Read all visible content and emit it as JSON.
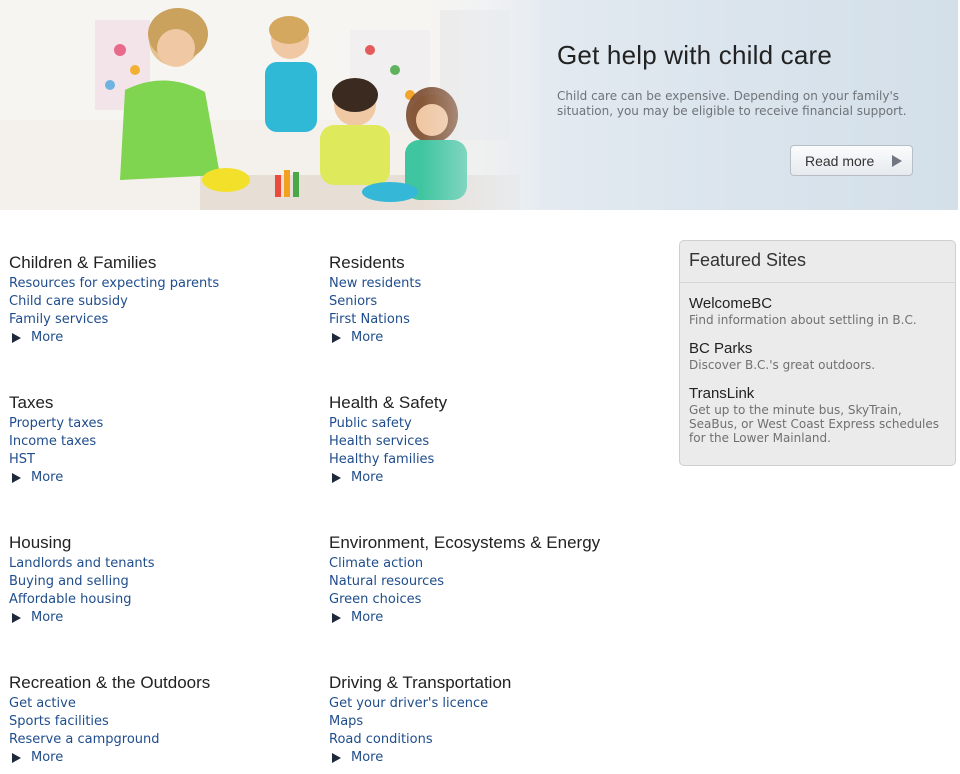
{
  "banner": {
    "title": "Get help with child care",
    "text": "Child care can be expensive. Depending on your family's situation, you may be eligible to receive financial support.",
    "read_more": "Read more"
  },
  "categories": [
    {
      "title": "Children & Families",
      "links": [
        "Resources for expecting parents",
        "Child care subsidy",
        "Family services"
      ],
      "more": "More"
    },
    {
      "title": "Residents",
      "links": [
        "New residents",
        "Seniors",
        "First Nations"
      ],
      "more": "More"
    },
    {
      "title": "Taxes",
      "links": [
        "Property taxes",
        "Income taxes",
        "HST"
      ],
      "more": "More"
    },
    {
      "title": "Health & Safety",
      "links": [
        "Public safety",
        "Health services",
        "Healthy families"
      ],
      "more": "More"
    },
    {
      "title": "Housing",
      "links": [
        "Landlords and tenants",
        "Buying and selling",
        "Affordable housing"
      ],
      "more": "More"
    },
    {
      "title": "Environment, Ecosystems & Energy",
      "links": [
        "Climate action",
        "Natural resources",
        "Green choices"
      ],
      "more": "More"
    },
    {
      "title": "Recreation & the Outdoors",
      "links": [
        "Get active",
        "Sports facilities",
        "Reserve a campground"
      ],
      "more": "More"
    },
    {
      "title": "Driving & Transportation",
      "links": [
        "Get your driver's licence",
        "Maps",
        "Road conditions"
      ],
      "more": "More"
    }
  ],
  "featured": {
    "title": "Featured Sites",
    "sites": [
      {
        "name": "WelcomeBC",
        "desc": "Find information about settling in B.C."
      },
      {
        "name": "BC Parks",
        "desc": "Discover B.C.'s great outdoors."
      },
      {
        "name": "TransLink",
        "desc": "Get up to the minute bus, SkyTrain, SeaBus, or West Coast Express schedules for the Lower Mainland."
      }
    ]
  },
  "colors": {
    "link": "#1f4d8c",
    "heading": "#222222",
    "banner_bg": "#dde6ee",
    "featured_bg": "#ebebeb"
  }
}
